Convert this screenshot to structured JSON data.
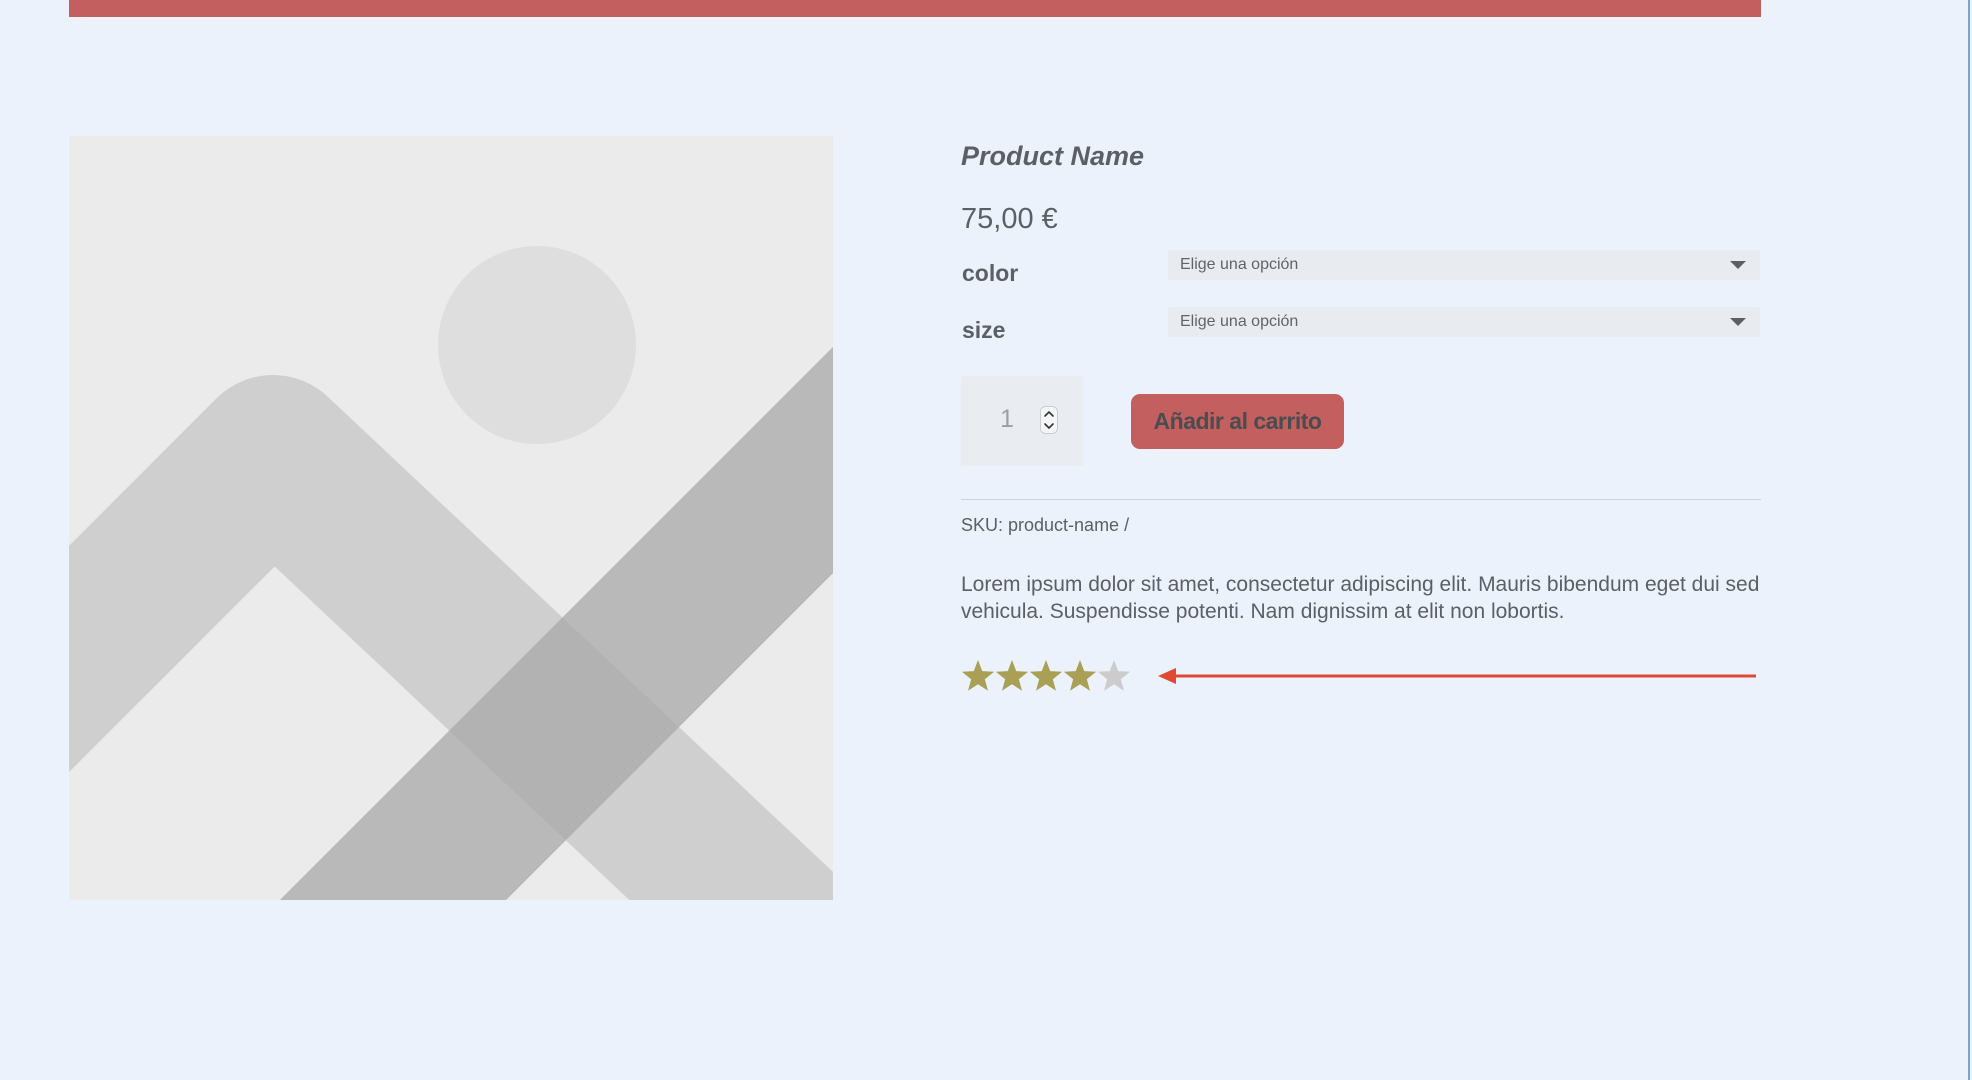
{
  "colors": {
    "page_background": "#ecf2fb",
    "accent": "#c45f5f",
    "price": "#c4605c",
    "star_filled": "#a9a055",
    "star_empty": "#cccccc",
    "annotation_arrow": "#e04a33",
    "text": "#5b5f66"
  },
  "icons": {
    "product_image": "image-placeholder-icon",
    "select_caret": "chevron-down-icon",
    "quantity_stepper": "up-down-stepper-icon",
    "rating": "star-icon",
    "annotation": "arrow-left-icon"
  },
  "product": {
    "name": "Product Name",
    "price": "75,00 €",
    "sku": "SKU: product-name /",
    "description": "Lorem ipsum dolor sit amet, consectetur adipiscing elit. Mauris bibendum eget dui sed vehicula. Suspendisse potenti. Nam dignissim at elit non lobortis.",
    "rating": {
      "value": 4,
      "max": 5
    }
  },
  "variations": [
    {
      "label": "color",
      "selected": "Elige una opción"
    },
    {
      "label": "size",
      "selected": "Elige una opción"
    }
  ],
  "cart": {
    "quantity": "1",
    "add_to_cart_label": "Añadir al carrito"
  }
}
